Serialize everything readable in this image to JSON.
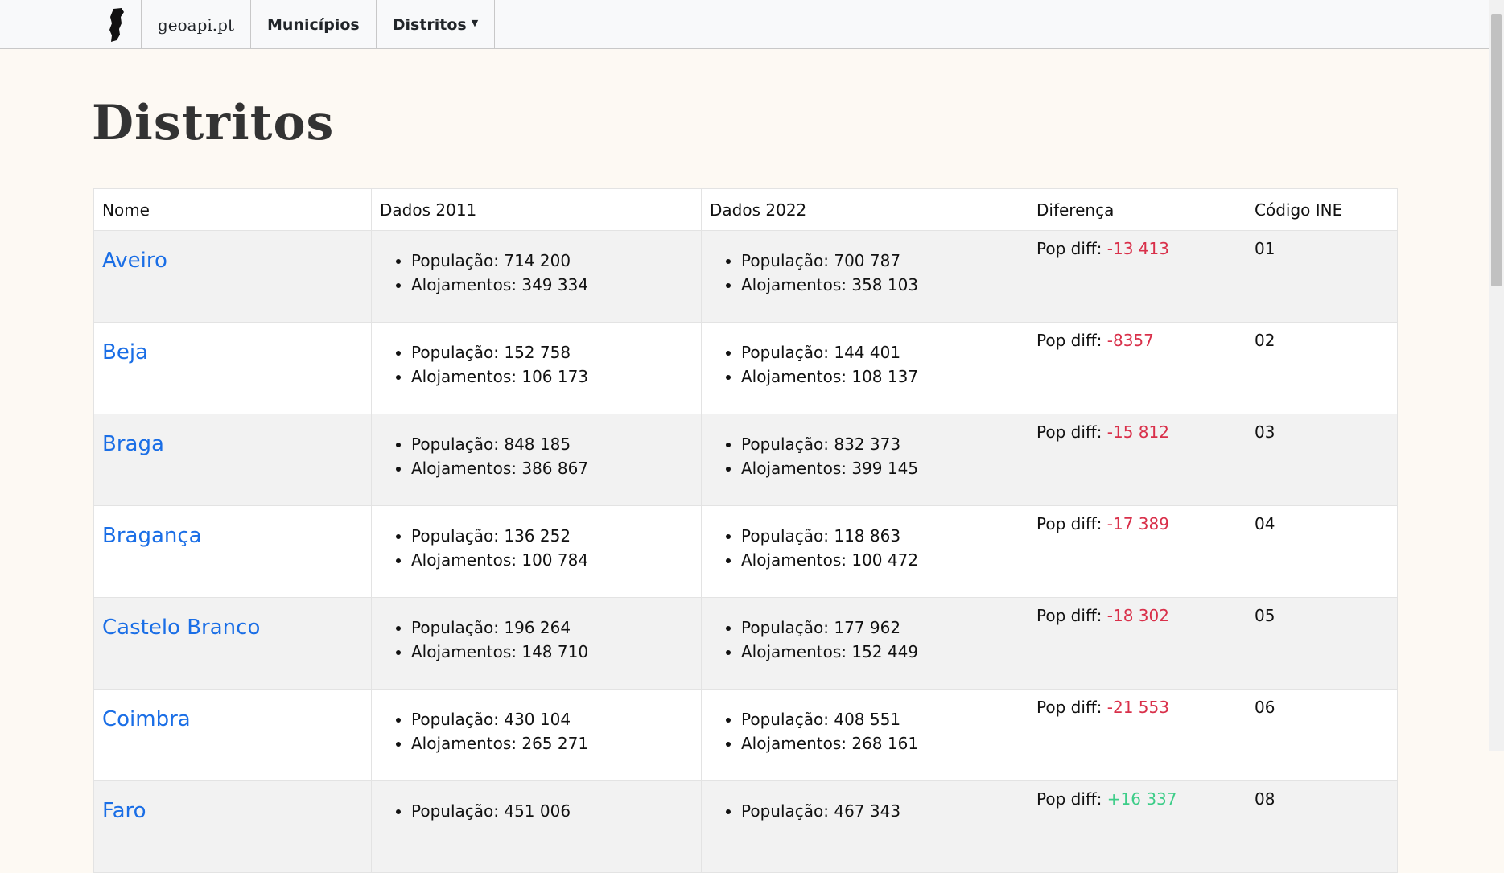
{
  "navbar": {
    "brand": "geoapi.pt",
    "links": [
      {
        "label": "Municípios"
      },
      {
        "label": "Distritos",
        "dropdown": true
      }
    ]
  },
  "page": {
    "title": "Distritos"
  },
  "table": {
    "headers": [
      "Nome",
      "Dados 2011",
      "Dados 2022",
      "Diferença",
      "Código INE"
    ],
    "pop_label": "População:",
    "aloj_label": "Alojamentos:",
    "diff_label": "Pop diff:",
    "rows": [
      {
        "name": "Aveiro",
        "pop2011": "714 200",
        "aloj2011": "349 334",
        "pop2022": "700 787",
        "aloj2022": "358 103",
        "diff": "-13 413",
        "code": "01"
      },
      {
        "name": "Beja",
        "pop2011": "152 758",
        "aloj2011": "106 173",
        "pop2022": "144 401",
        "aloj2022": "108 137",
        "diff": "-8357",
        "code": "02"
      },
      {
        "name": "Braga",
        "pop2011": "848 185",
        "aloj2011": "386 867",
        "pop2022": "832 373",
        "aloj2022": "399 145",
        "diff": "-15 812",
        "code": "03"
      },
      {
        "name": "Bragança",
        "pop2011": "136 252",
        "aloj2011": "100 784",
        "pop2022": "118 863",
        "aloj2022": "100 472",
        "diff": "-17 389",
        "code": "04"
      },
      {
        "name": "Castelo Branco",
        "pop2011": "196 264",
        "aloj2011": "148 710",
        "pop2022": "177 962",
        "aloj2022": "152 449",
        "diff": "-18 302",
        "code": "05"
      },
      {
        "name": "Coimbra",
        "pop2011": "430 104",
        "aloj2011": "265 271",
        "pop2022": "408 551",
        "aloj2022": "268 161",
        "diff": "-21 553",
        "code": "06"
      },
      {
        "name": "Faro",
        "pop2011": "451 006",
        "aloj2011": "",
        "pop2022": "467 343",
        "aloj2022": "",
        "diff": "+16 337",
        "code": "08"
      }
    ]
  },
  "colors": {
    "link": "#1a6ee6",
    "negative": "#d9304a",
    "positive": "#3ccd88",
    "background": "#fdf9f3",
    "row_stripe": "#f2f2f2"
  },
  "icons": {
    "logo": "portugal-map-icon",
    "dropdown": "caret-down-icon"
  }
}
